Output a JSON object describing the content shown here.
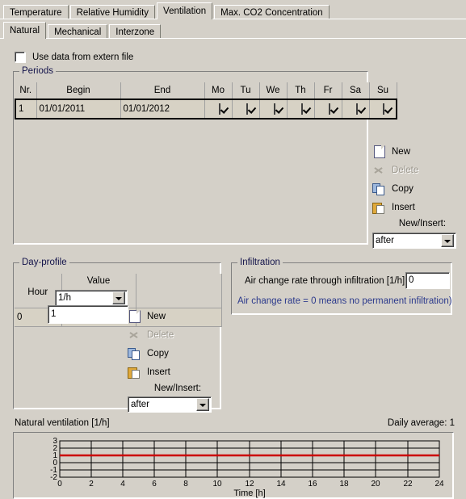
{
  "outer_tabs": [
    {
      "label": "Temperature",
      "active": false
    },
    {
      "label": "Relative Humidity",
      "active": false
    },
    {
      "label": "Ventilation",
      "active": true
    },
    {
      "label": "Max. CO2 Concentration",
      "active": false
    }
  ],
  "inner_tabs": [
    {
      "label": "Natural",
      "active": true
    },
    {
      "label": "Mechanical",
      "active": false
    },
    {
      "label": "Interzone",
      "active": false
    }
  ],
  "extern_file": {
    "label": "Use data from extern file",
    "checked": false
  },
  "periods": {
    "title": "Periods",
    "columns": [
      "Nr.",
      "Begin",
      "End",
      "Mo",
      "Tu",
      "We",
      "Th",
      "Fr",
      "Sa",
      "Su"
    ],
    "rows": [
      {
        "nr": "1",
        "begin": "01/01/2011",
        "end": "01/01/2012",
        "days": [
          true,
          true,
          true,
          true,
          true,
          true,
          true
        ],
        "selected": true
      }
    ],
    "actions": [
      {
        "label": "New",
        "icon": "new-page-icon",
        "enabled": true
      },
      {
        "label": "Delete",
        "icon": "scissors-icon",
        "enabled": false
      },
      {
        "label": "Copy",
        "icon": "copy-icon",
        "enabled": true
      },
      {
        "label": "Insert",
        "icon": "paste-icon",
        "enabled": true
      }
    ],
    "newinsert_label": "New/Insert:",
    "newinsert_value": "after"
  },
  "dayprofile": {
    "title": "Day-profile",
    "columns": [
      "Hour",
      "Value"
    ],
    "unit_value": "1/h",
    "rows": [
      {
        "hour": "0",
        "value": "1"
      }
    ],
    "actions": [
      {
        "label": "New",
        "icon": "new-page-icon",
        "enabled": true
      },
      {
        "label": "Delete",
        "icon": "scissors-icon",
        "enabled": false
      },
      {
        "label": "Copy",
        "icon": "copy-icon",
        "enabled": true
      },
      {
        "label": "Insert",
        "icon": "paste-icon",
        "enabled": true
      }
    ],
    "newinsert_label": "New/Insert:",
    "newinsert_value": "after"
  },
  "infiltration": {
    "title": "Infiltration",
    "rate_label": "Air change rate through infiltration  [1/h]",
    "rate_value": "0",
    "note": "Air change rate = 0 means no permanent infiltration)"
  },
  "chart_panel": {
    "caption": "Natural ventilation [1/h]",
    "daily_average": "Daily average: 1"
  },
  "chart_data": {
    "type": "line",
    "title": "Natural ventilation [1/h]",
    "xlabel": "Time [h]",
    "ylabel": "",
    "x": [
      0,
      24
    ],
    "series": [
      {
        "name": "Natural ventilation",
        "values": [
          1,
          1
        ],
        "color": "#cc0000"
      }
    ],
    "xlim": [
      0,
      24
    ],
    "ylim": [
      -2,
      3
    ],
    "xticks": [
      0,
      2,
      4,
      6,
      8,
      10,
      12,
      14,
      16,
      18,
      20,
      22,
      24
    ],
    "yticks": [
      3,
      2,
      1,
      0,
      -1,
      -2
    ],
    "xtick_labels": [
      "0",
      "2",
      "4",
      "6",
      "8",
      "10",
      "12",
      "14",
      "16",
      "18",
      "20",
      "22",
      "24"
    ],
    "ytick_labels": [
      "3",
      "2",
      "1",
      "0",
      "-1",
      "-2"
    ],
    "grid": true,
    "legend": "none"
  },
  "colors": {
    "face": "#d4d0c8",
    "grid_cell": "#d7d2c5",
    "group_title": "#13134a",
    "note": "#2c3a8c",
    "series": "#cc0000"
  }
}
